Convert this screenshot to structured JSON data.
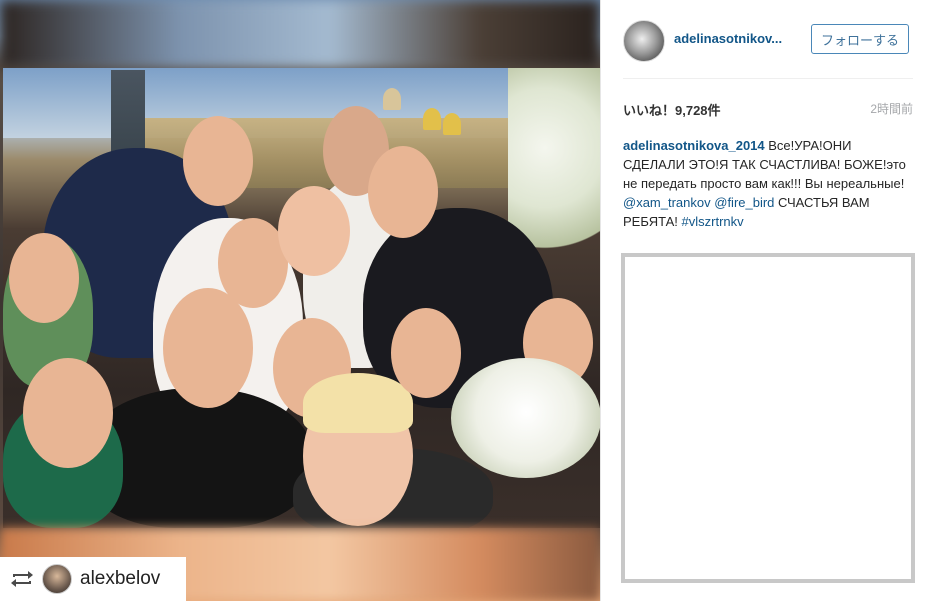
{
  "post": {
    "username": "adelinasotnikov...",
    "follow_label": "フォローする",
    "likes": "いいね！9,728件",
    "time": "2時間前",
    "caption": {
      "user": "adelinasotnikova_2014",
      "text1": " Все!УРА!ОНИ СДЕЛАЛИ ЭТО!Я ТАК СЧАСТЛИВА! БОЖЕ!это не передать просто вам как!!! Вы нереальные! ",
      "mention1": "@xam_trankov",
      "mention2": "@fire_bird",
      "text2": " СЧАСТЬЯ ВАМ РЕБЯТА! ",
      "hashtag": "#vlszrtrnkv"
    }
  },
  "repost": {
    "icon": "repost-icon",
    "username": "alexbelov"
  },
  "colors": {
    "link": "#125688",
    "follow_border": "#4a87b8",
    "comment_box_border": "#c8c8c8"
  }
}
